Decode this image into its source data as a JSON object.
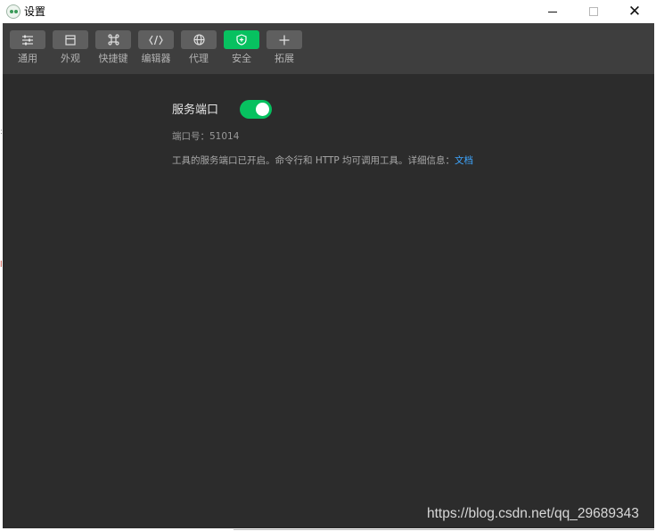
{
  "window": {
    "title": "设置",
    "controls": {
      "minimize": "minimize",
      "maximize": "maximize",
      "close": "✕"
    }
  },
  "toolbar": {
    "items": [
      {
        "label": "通用",
        "icon": "sliders-icon",
        "active": false
      },
      {
        "label": "外观",
        "icon": "window-layout-icon",
        "active": false
      },
      {
        "label": "快捷键",
        "icon": "command-key-icon",
        "active": false
      },
      {
        "label": "编辑器",
        "icon": "code-brackets-icon",
        "active": false
      },
      {
        "label": "代理",
        "icon": "globe-icon",
        "active": false
      },
      {
        "label": "安全",
        "icon": "shield-icon",
        "active": true
      },
      {
        "label": "拓展",
        "icon": "plus-icon",
        "active": false
      }
    ]
  },
  "security": {
    "service_port_label": "服务端口",
    "service_port_enabled": true,
    "port_number_text": "端口号：51014",
    "description": "工具的服务端口已开启。命令行和 HTTP 均可调用工具。详细信息：",
    "doc_link": "文档"
  },
  "watermark": "https://blog.csdn.net/qq_29689343",
  "colors": {
    "toolbar_bg": "#3e3e3e",
    "content_bg": "#2c2c2c",
    "accent": "#07c160",
    "link": "#3ea6ff"
  }
}
